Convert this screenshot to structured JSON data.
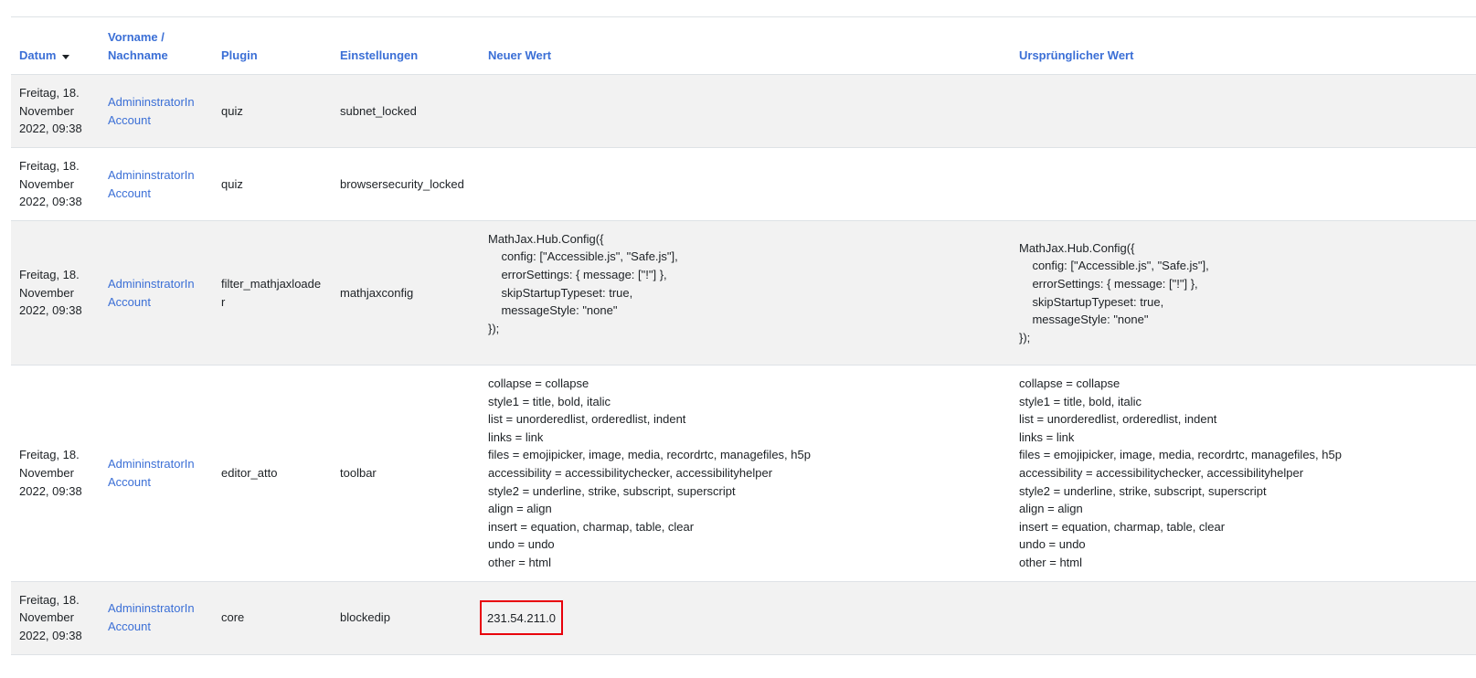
{
  "header": {
    "date": "Datum",
    "name": "Vorname / Nachname",
    "plugin": "Plugin",
    "setting": "Einstellungen",
    "new_value": "Neuer Wert",
    "old_value": "Ursprünglicher Wert"
  },
  "rows": [
    {
      "date": "Freitag, 18. November 2022, 09:38",
      "user": "AdmininstratorIn Account",
      "plugin": "quiz",
      "setting": "subnet_locked",
      "new_value": "",
      "old_value": ""
    },
    {
      "date": "Freitag, 18. November 2022, 09:38",
      "user": "AdmininstratorIn Account",
      "plugin": "quiz",
      "setting": "browsersecurity_locked",
      "new_value": "",
      "old_value": ""
    },
    {
      "date": "Freitag, 18. November 2022, 09:38",
      "user": "AdmininstratorIn Account",
      "plugin": "filter_mathjaxloader",
      "setting": "mathjaxconfig",
      "new_value": "MathJax.Hub.Config({\n    config: [\"Accessible.js\", \"Safe.js\"],\n    errorSettings: { message: [\"!\"] },\n    skipStartupTypeset: true,\n    messageStyle: \"none\"\n});",
      "old_value": "MathJax.Hub.Config({\n    config: [\"Accessible.js\", \"Safe.js\"],\n    errorSettings: { message: [\"!\"] },\n    skipStartupTypeset: true,\n    messageStyle: \"none\"\n});"
    },
    {
      "date": "Freitag, 18. November 2022, 09:38",
      "user": "AdmininstratorIn Account",
      "plugin": "editor_atto",
      "setting": "toolbar",
      "new_value": "collapse = collapse\nstyle1 = title, bold, italic\nlist = unorderedlist, orderedlist, indent\nlinks = link\nfiles = emojipicker, image, media, recordrtc, managefiles, h5p\naccessibility = accessibilitychecker, accessibilityhelper\nstyle2 = underline, strike, subscript, superscript\nalign = align\ninsert = equation, charmap, table, clear\nundo = undo\nother = html",
      "old_value": "collapse = collapse\nstyle1 = title, bold, italic\nlist = unorderedlist, orderedlist, indent\nlinks = link\nfiles = emojipicker, image, media, recordrtc, managefiles, h5p\naccessibility = accessibilitychecker, accessibilityhelper\nstyle2 = underline, strike, subscript, superscript\nalign = align\ninsert = equation, charmap, table, clear\nundo = undo\nother = html"
    },
    {
      "date": "Freitag, 18. November 2022, 09:38",
      "user": "AdmininstratorIn Account",
      "plugin": "core",
      "setting": "blockedip",
      "new_value": "231.54.211.0",
      "old_value": ""
    }
  ],
  "colors": {
    "link": "#3b6fd6",
    "highlight_border": "#e8000b",
    "row_stripe": "#f2f2f2"
  }
}
